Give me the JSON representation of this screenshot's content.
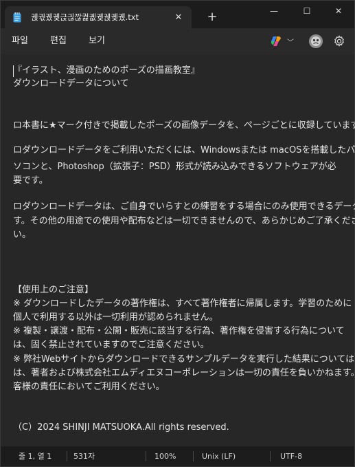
{
  "tab": {
    "title": "궩궋궸궻귽긚깒궕궶궻궩궻궸.txt",
    "close": "✕"
  },
  "new_tab": "+",
  "window_controls": {
    "minimize": "—",
    "maximize": "☐",
    "close": "✕"
  },
  "menu": {
    "file": "파일",
    "edit": "편집",
    "view": "보기"
  },
  "editor_lines": [
    "『イラスト、漫画のためのポーズの描画教室』",
    "ダウンロードデータについて",
    "",
    "",
    "ロ本書に★マーク付きで掲載したポーズの画像データを、ページごとに収録しています。",
    "",
    "ロダウンロードデータをご利用いただくには、Windowsまたは macOSを搭載したパ",
    "ソコンと、Photoshop（拡張子：PSD）形式が読み込みできるソフトウェアが必",
    "要です。",
    "",
    "ロダウンロードデータは、ご自身でいらすとの練習をする場合にのみ使用できるデータで",
    "す。その他の用途での使用や配布などは一切できませんので、あらかじめご了承くださ",
    "い。",
    "",
    "",
    "",
    "【使用上のご注意】",
    "※ ダウンロードしたデータの著作権は、すべて著作権者に帰属します。学習のために",
    "個人で利用する以外は一切利用が認められません。",
    "※ 複製・譲渡・配布・公開・販売に該当する行為、著作権を侵害する行為について",
    "は、固く禁止されていますのでご注意ください。",
    "※ 弊社Webサイトからダウンロードできるサンプルデータを実行した結果については",
    "は、著者および株式会社エムディエヌコーポレーションは一切の責任を負いかねます。お",
    "客様の責任においてご利用ください。",
    "",
    "",
    "",
    "（C）2024 SHINJI MATSUOKA.All rights reserved."
  ],
  "status": {
    "position": "줄 1, 열 1",
    "chars": "531자",
    "zoom": "100%",
    "line_ending": "Unix (LF)",
    "encoding": "UTF-8"
  },
  "colors": {
    "background": "#1f1f1f",
    "editor": "#272727",
    "menubar": "#2a2a2a",
    "text": "#e4e4e4"
  },
  "icons": [
    "notepad-icon",
    "copilot-icon",
    "chevron-down-icon",
    "avatar",
    "gear-icon"
  ]
}
